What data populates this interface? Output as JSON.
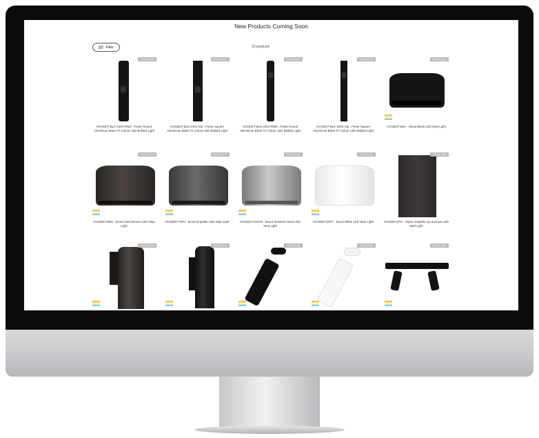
{
  "page": {
    "title": "New Products Coming Soon",
    "filter_label": "Filter",
    "product_count": "23 products"
  },
  "products": [
    {
      "name": "HV1630T-BLK-240V-RND - Fedor Round Aluminium Black Tri Colour LED Bollard Light",
      "badge": "Coming soon"
    },
    {
      "name": "HV1630T-BLK-240V-SQ - Fedor Square Aluminium Black Tri Colour LED Bollard Light",
      "badge": "Coming soon"
    },
    {
      "name": "HV1631T-BLK-240V-RND - Fedor Round Aluminium Black Tri Colour LED Bollard Light",
      "badge": "Coming soon"
    },
    {
      "name": "HV1631T-BLK-240V-SQ - Fedor Square Aluminium Black Tri Colour LED Bollard Light",
      "badge": "Coming soon"
    },
    {
      "name": "HV3282T-BLK - Mood Black LED Step Light",
      "badge": "Coming soon"
    },
    {
      "name": "HV3282T-BRZ - Mood Solid Bronze LED Step Light",
      "badge": "Coming soon"
    },
    {
      "name": "HV3282T-GPH - Mood Graphite LED Step Light",
      "badge": "Coming soon"
    },
    {
      "name": "HV3282T-SS316 - Mood Stainless Steel LED Step Light",
      "badge": "Coming soon"
    },
    {
      "name": "HV3282T-WHT - Mood White LED Step Light",
      "badge": "Coming soon"
    },
    {
      "name": "HV3289-GPH - Stylez Graphite Up & Down LED Wall Light",
      "badge": "Coming soon"
    },
    {
      "name": "",
      "badge": "Coming soon"
    },
    {
      "name": "",
      "badge": "Coming soon"
    },
    {
      "name": "",
      "badge": "Coming soon"
    },
    {
      "name": "",
      "badge": "Coming soon"
    },
    {
      "name": "",
      "badge": "Coming soon"
    }
  ],
  "colors": {
    "badge": "#b9b9b9",
    "bezel": "#0b0b0c",
    "product_black": "#151515"
  },
  "icons": {
    "filter": "sliders-icon",
    "swatch": "colour-temperature-icon"
  }
}
